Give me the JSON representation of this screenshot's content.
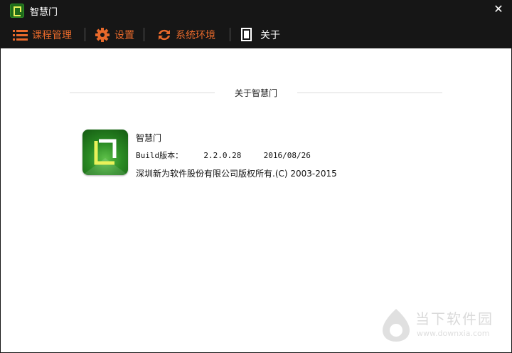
{
  "window": {
    "title": "智慧门"
  },
  "toolbar": {
    "items": [
      {
        "label": "课程管理",
        "icon": "list-icon"
      },
      {
        "label": "设置",
        "icon": "gear-icon"
      },
      {
        "label": "系统环境",
        "icon": "refresh-icon"
      },
      {
        "label": "关于",
        "icon": "document-icon"
      }
    ]
  },
  "about": {
    "section_title": "关于智慧门",
    "app_name": "智慧门",
    "build_label": "Build版本：",
    "build_version": "2.2.0.28",
    "build_date": "2016/08/26",
    "copyright": "深圳新为软件股份有限公司版权所有.(C) 2003-2015"
  },
  "watermark": {
    "name": "当下软件园",
    "url": "www.downxia.com"
  },
  "colors": {
    "accent": "#e8692b",
    "titlebar": "#161616",
    "logo_green": "#2a8a23",
    "logo_yellow": "#e9f15a"
  }
}
